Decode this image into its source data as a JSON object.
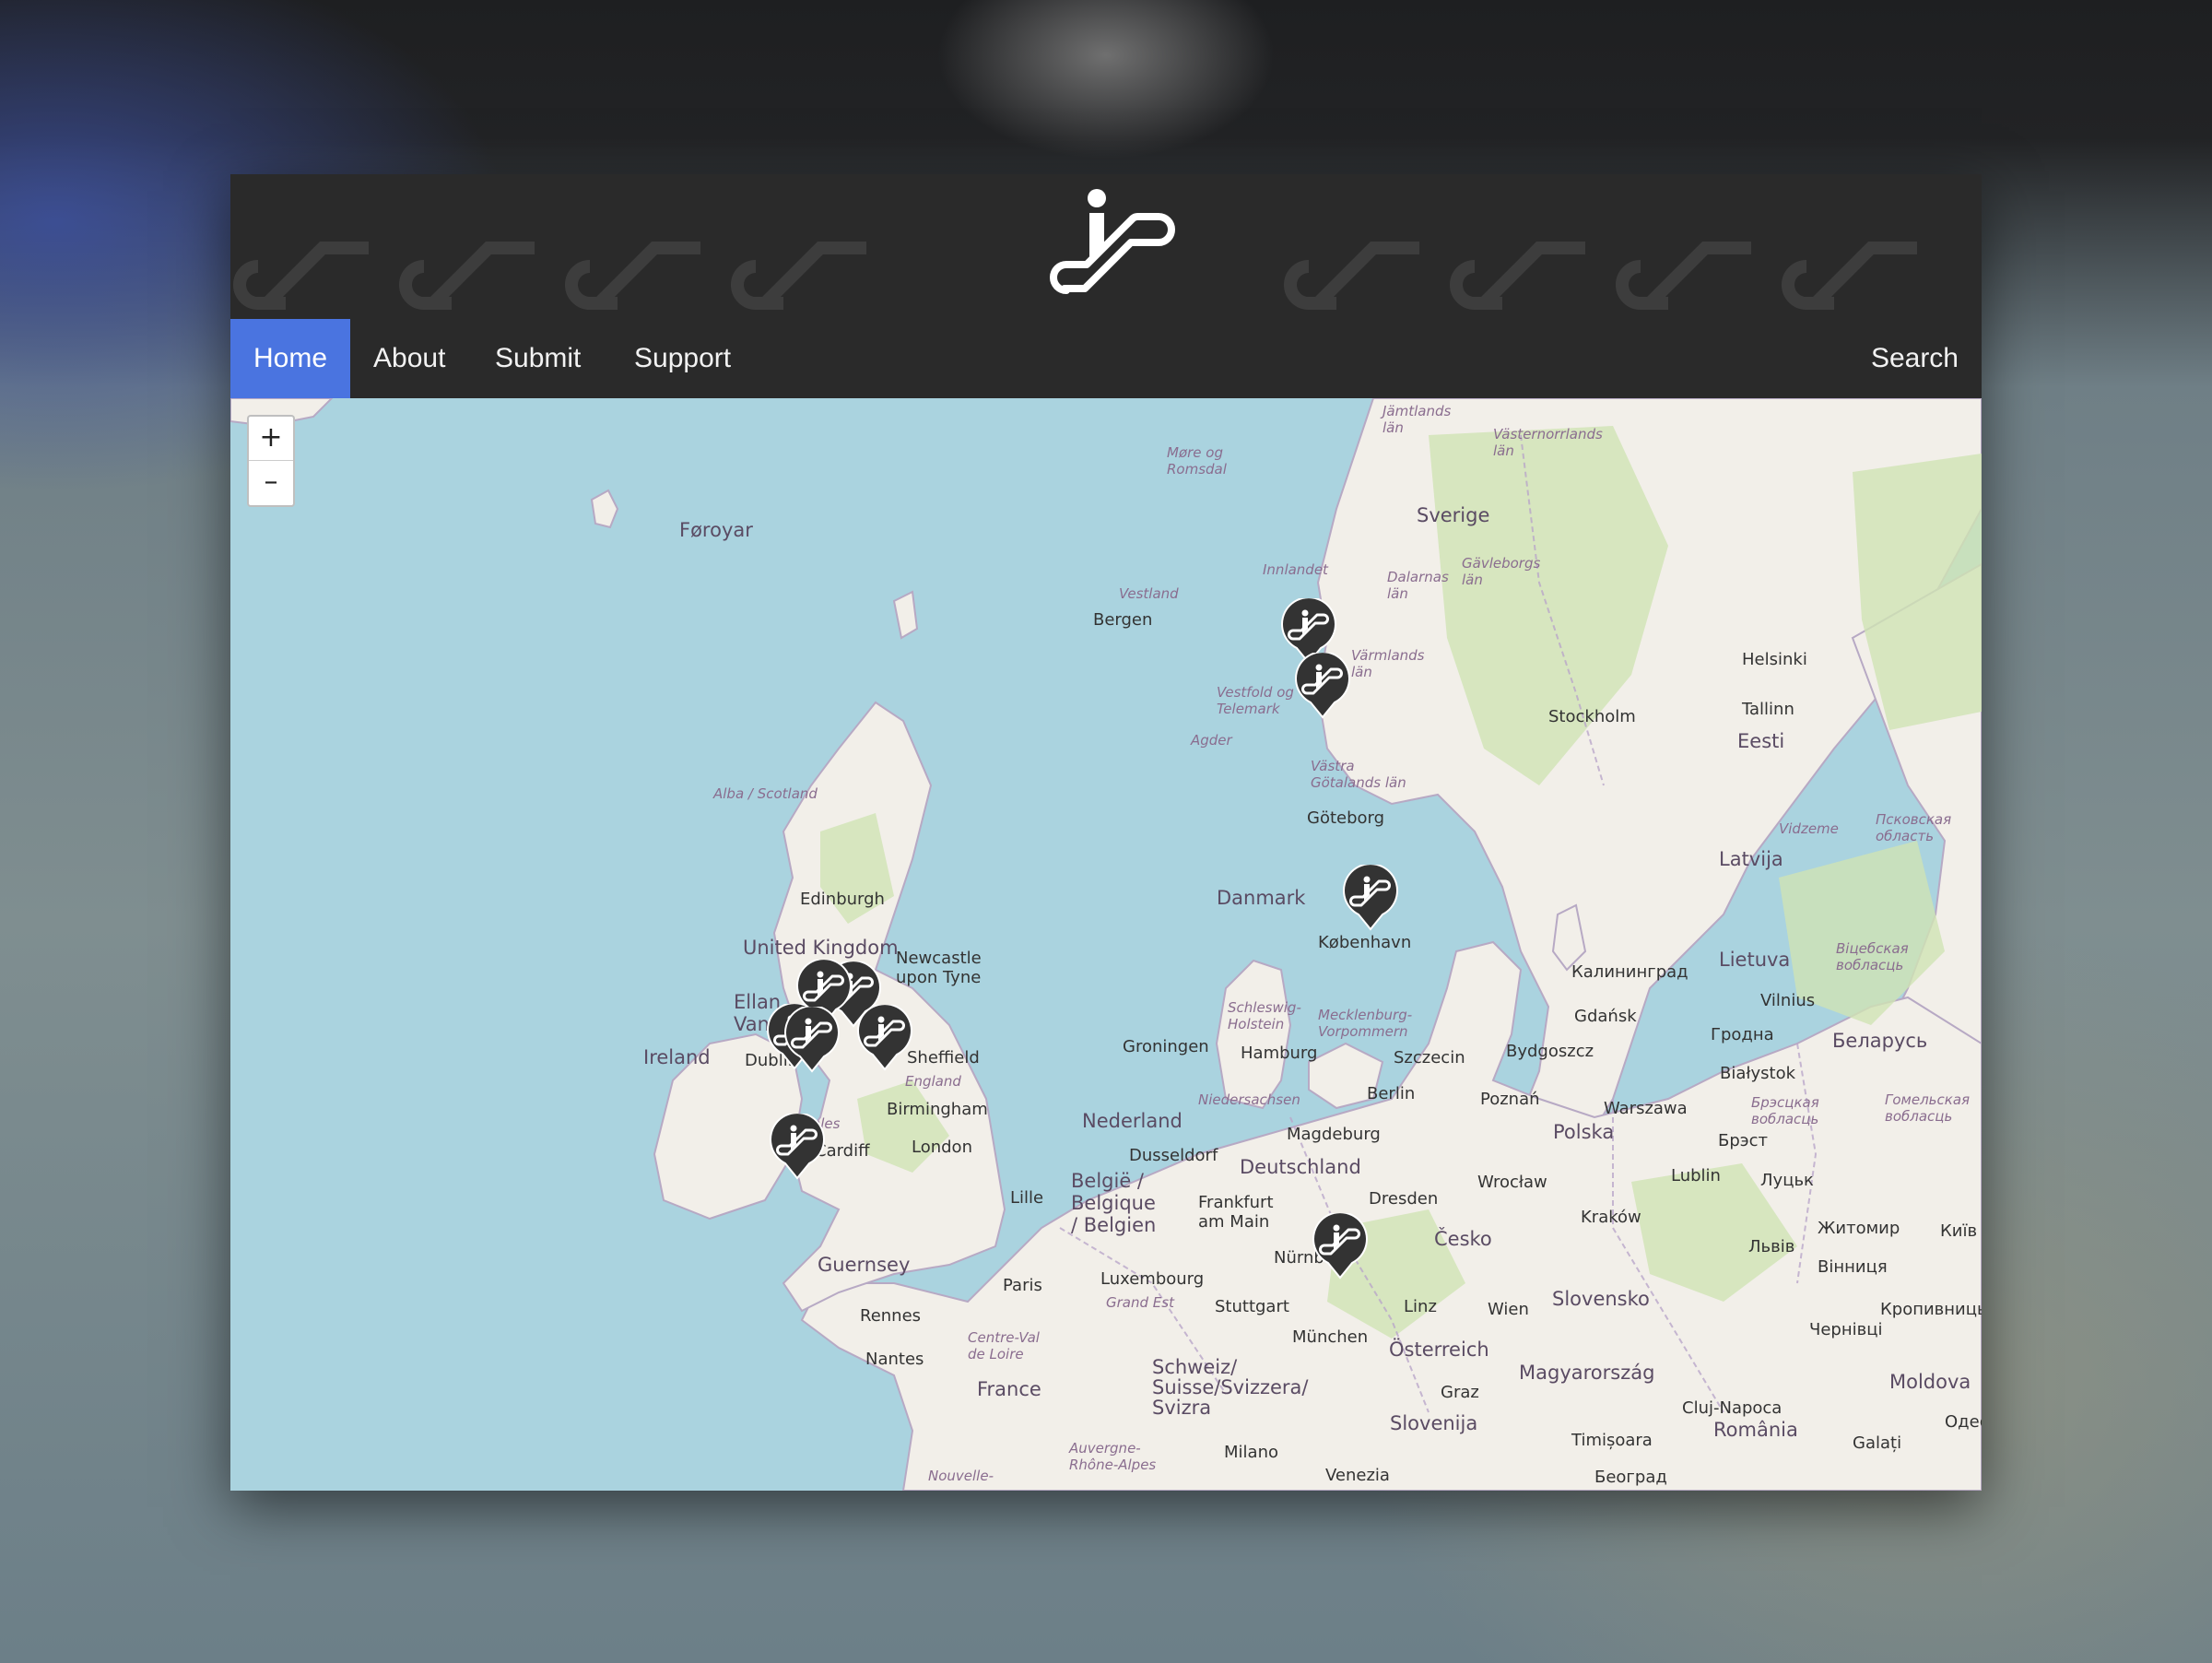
{
  "nav": {
    "home": "Home",
    "about": "About",
    "submit": "Submit",
    "support": "Support",
    "search": "Search"
  },
  "colors": {
    "header_bg": "#2a2a2a",
    "nav_active": "#4a74e0",
    "water": "#aad3df",
    "land": "#f2efe9",
    "marker": "#333333"
  },
  "zoom": {
    "in": "+",
    "out": "–"
  },
  "map_labels": {
    "foroyar": "Føroyar",
    "more_romsdal": "Møre og Romsdal",
    "jamtlands": "Jämtlands län",
    "vasternorrlands": "Västernorrlands län",
    "sverige": "Sverige",
    "innlandet": "Innlandet",
    "dalarnas": "Dalarnas län",
    "gavleborgs": "Gävleborgs län",
    "vestland": "Vestland",
    "bergen": "Bergen",
    "varmlands": "Värmlands län",
    "vestfold": "Vestfold og Telemark",
    "agder": "Agder",
    "helsinki": "Helsinki",
    "tallinn": "Tallinn",
    "eesti": "Eesti",
    "stockholm": "Stockholm",
    "vastra": "Västra Götalands län",
    "goteborg": "Göteborg",
    "alba": "Alba / Scotland",
    "edinburgh": "Edinburgh",
    "united_kingdom": "United Kingdom",
    "newcastle": "Newcastle upon Tyne",
    "ellan": "Ellan Vannin",
    "ireland": "Ireland",
    "dublin": "Dublin",
    "sheffield": "Sheffield",
    "england": "England",
    "birmingham": "Birmingham",
    "wales": "Wales",
    "cardiff": "Cardiff",
    "london": "London",
    "guernsey": "Guernsey",
    "danmark": "Danmark",
    "kobenhavn": "København",
    "latvija": "Latvija",
    "vidzeme": "Vidzeme",
    "pskov": "Псковская область",
    "lietuva": "Lietuva",
    "kaliningrad": "Калининград",
    "vitebsk": "Віцебская вобласць",
    "vilnius": "Vilnius",
    "gdansk": "Gdańsk",
    "schleswig": "Schleswig-Holstein",
    "mecklenburg": "Mecklenburg-Vorpommern",
    "groningen": "Groningen",
    "hamburg": "Hamburg",
    "szczecin": "Szczecin",
    "bydgoszcz": "Bydgoszcz",
    "grodno": "Гродна",
    "bialystok": "Białystok",
    "belarus": "Беларусь",
    "niedersachsen": "Niedersachsen",
    "berlin": "Berlin",
    "poznan": "Poznań",
    "warszawa": "Warszawa",
    "brest": "Брэсцкая вобласць",
    "gomel": "Гомельская вобласць",
    "nederland": "Nederland",
    "magdeburg": "Magdeburg",
    "polska": "Polska",
    "brest_city": "Брэст",
    "dusseldorf": "Dusseldorf",
    "deutschland": "Deutschland",
    "wroclaw": "Wrocław",
    "lublin": "Lublin",
    "lutsk": "Луцьк",
    "zhytomyr": "Житомир",
    "kyiv": "Київ",
    "lille": "Lille",
    "belgie": "België / Belgique / Belgien",
    "frankfurt": "Frankfurt am Main",
    "dresden": "Dresden",
    "krakow": "Kraków",
    "cesko": "Česko",
    "lviv": "Львів",
    "vinnytsia": "Вінниця",
    "paris": "Paris",
    "luxembourg": "Luxembourg",
    "nurnberg": "Nürnberg",
    "grand_est": "Grand Est",
    "stuttgart": "Stuttgart",
    "linz": "Linz",
    "wien": "Wien",
    "slovensko": "Slovensko",
    "kropyvnytskyi": "Кропивницький",
    "rennes": "Rennes",
    "munchen": "München",
    "osterreich": "Österreich",
    "chernivtsi": "Чернівці",
    "nantes": "Nantes",
    "centre_val": "Centre-Val de Loire",
    "schweiz": "Schweiz/ Suisse/Svizzera/ Svizra",
    "graz": "Graz",
    "magyarorszag": "Magyarország",
    "moldova": "Moldova",
    "france": "France",
    "cluj": "Cluj-Napoca",
    "odesa": "Одеса",
    "slovenija": "Slovenija",
    "romania": "România",
    "timisoara": "Timișoara",
    "galati": "Galați",
    "milano": "Milano",
    "auvergne": "Auvergne-Rhône-Alpes",
    "nouvelle": "Nouvelle-",
    "venezia": "Venezia",
    "beograd": "Београд"
  },
  "markers": [
    {
      "name": "escalator-marker",
      "icon": "escalator-icon"
    },
    {
      "name": "escalator-marker",
      "icon": "escalator-icon"
    },
    {
      "name": "escalator-marker",
      "icon": "escalator-icon"
    },
    {
      "name": "escalator-marker",
      "icon": "escalator-icon"
    },
    {
      "name": "escalator-marker",
      "icon": "escalator-icon"
    },
    {
      "name": "escalator-marker",
      "icon": "escalator-icon"
    },
    {
      "name": "escalator-marker",
      "icon": "escalator-icon"
    },
    {
      "name": "escalator-marker",
      "icon": "escalator-icon"
    },
    {
      "name": "escalator-marker",
      "icon": "escalator-icon"
    },
    {
      "name": "escalator-marker",
      "icon": "escalator-icon"
    }
  ]
}
